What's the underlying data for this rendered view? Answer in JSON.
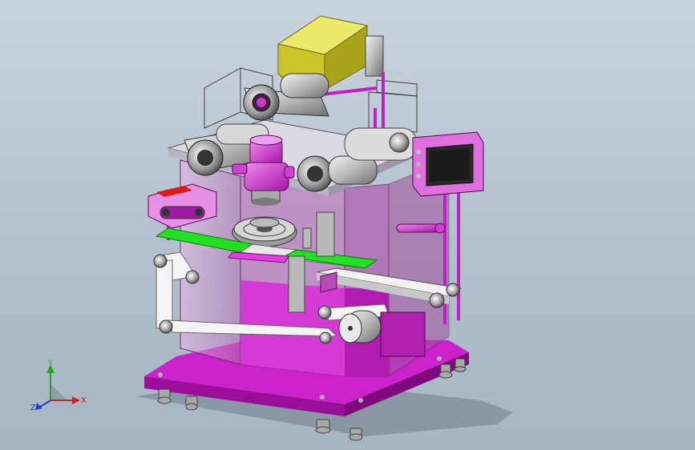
{
  "triad": {
    "y_label": "Y",
    "x_label": "X",
    "z_label": "Z",
    "y_color": "#1fa51f",
    "x_color": "#d21f1f",
    "z_color": "#1f3fd2"
  },
  "colors": {
    "background_top": "#c9d3de",
    "background_bottom": "#a8b6c4",
    "frame_magenta": "#e070e0",
    "base_magenta": "#cc22cc",
    "hopper_yellow": "#d8d23a",
    "belt_green": "#22e022",
    "panel_dark": "#2a2a2a",
    "accent_red": "#e01818"
  }
}
